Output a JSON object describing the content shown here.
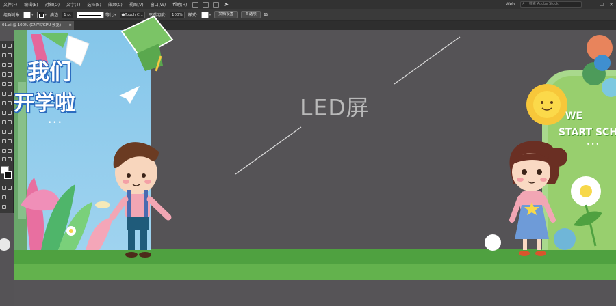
{
  "menu": {
    "items": [
      "文件(F)",
      "编辑(E)",
      "对象(O)",
      "文字(T)",
      "选择(S)",
      "效果(C)",
      "视图(V)",
      "窗口(W)",
      "帮助(H)"
    ],
    "workspace": "Web",
    "stock_search_placeholder": "搜索 Adobe Stock"
  },
  "control": {
    "selection_label": "组群对象",
    "stroke_label": "描边",
    "stroke_weight": "1 pt",
    "stroke_style": "等比",
    "brush": "Touch C...",
    "opacity_label": "不透明度:",
    "opacity_value": "100%",
    "style_label": "样式:",
    "doc_setup_button": "文档设置",
    "preferences_button": "首选项"
  },
  "document": {
    "tab_title": "01.ai @ 100% (CMYK/GPU 预览)",
    "close_glyph": "×"
  },
  "artwork": {
    "led_label": "LED屏",
    "left_title_line1": "我们",
    "left_title_line2": "开学啦",
    "left_dots": "•••",
    "right_title_line1": "WE",
    "right_title_line2": "START SCHO",
    "right_dots": "•••"
  },
  "colors": {
    "ui_dark": "#323232",
    "canvas_gray": "#555356",
    "sky_blue": "#8fc8e8",
    "grass_green": "#4fa140",
    "board_green": "#98cf6e"
  }
}
